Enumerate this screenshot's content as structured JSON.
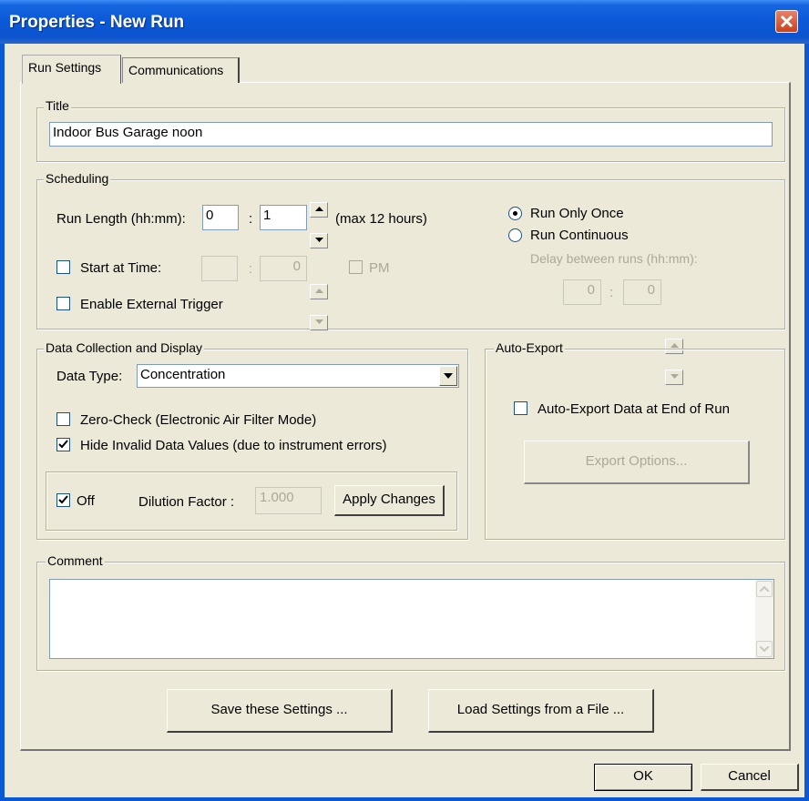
{
  "window": {
    "title": "Properties - New Run"
  },
  "tabs": [
    {
      "label": "Run Settings"
    },
    {
      "label": "Communications"
    }
  ],
  "title_group": {
    "label": "Title",
    "value": "Indoor Bus Garage noon"
  },
  "scheduling": {
    "label": "Scheduling",
    "run_length_label": "Run Length (hh:mm):",
    "run_length_hours": "0",
    "run_length_minutes": "1",
    "separator": ":",
    "max_note": "(max 12 hours)",
    "start_at_time_label": "Start at Time:",
    "start_at_time_checked": false,
    "start_hours": "",
    "start_minutes": "0",
    "pm_label": "PM",
    "enable_trigger_label": "Enable External Trigger",
    "run_only_once_label": "Run Only Once",
    "run_continuous_label": "Run Continuous",
    "selected_mode": "Run Only Once",
    "delay_label": "Delay between runs (hh:mm):",
    "delay_hours": "0",
    "delay_minutes": "0"
  },
  "data_collection": {
    "label": "Data Collection and Display",
    "data_type_label": "Data Type:",
    "data_type_value": "Concentration",
    "zero_check_label": "Zero-Check (Electronic Air Filter Mode)",
    "zero_check_checked": false,
    "hide_invalid_label": "Hide Invalid Data Values (due to instrument errors)",
    "hide_invalid_checked": true,
    "off_label": "Off",
    "off_checked": true,
    "dilution_label": "Dilution Factor :",
    "dilution_value": "1.000",
    "apply_label": "Apply Changes"
  },
  "auto_export": {
    "label": "Auto-Export",
    "checkbox_label": "Auto-Export Data at End of Run",
    "checked": false,
    "options_button": "Export Options..."
  },
  "comment": {
    "label": "Comment",
    "value": ""
  },
  "buttons": {
    "save_settings": "Save these Settings ...",
    "load_settings": "Load Settings from a File ...",
    "ok": "OK",
    "cancel": "Cancel"
  },
  "colors": {
    "titlebar": "#0a58d6",
    "dialog_bg": "#ece9d8",
    "close_button": "#d8543a"
  }
}
